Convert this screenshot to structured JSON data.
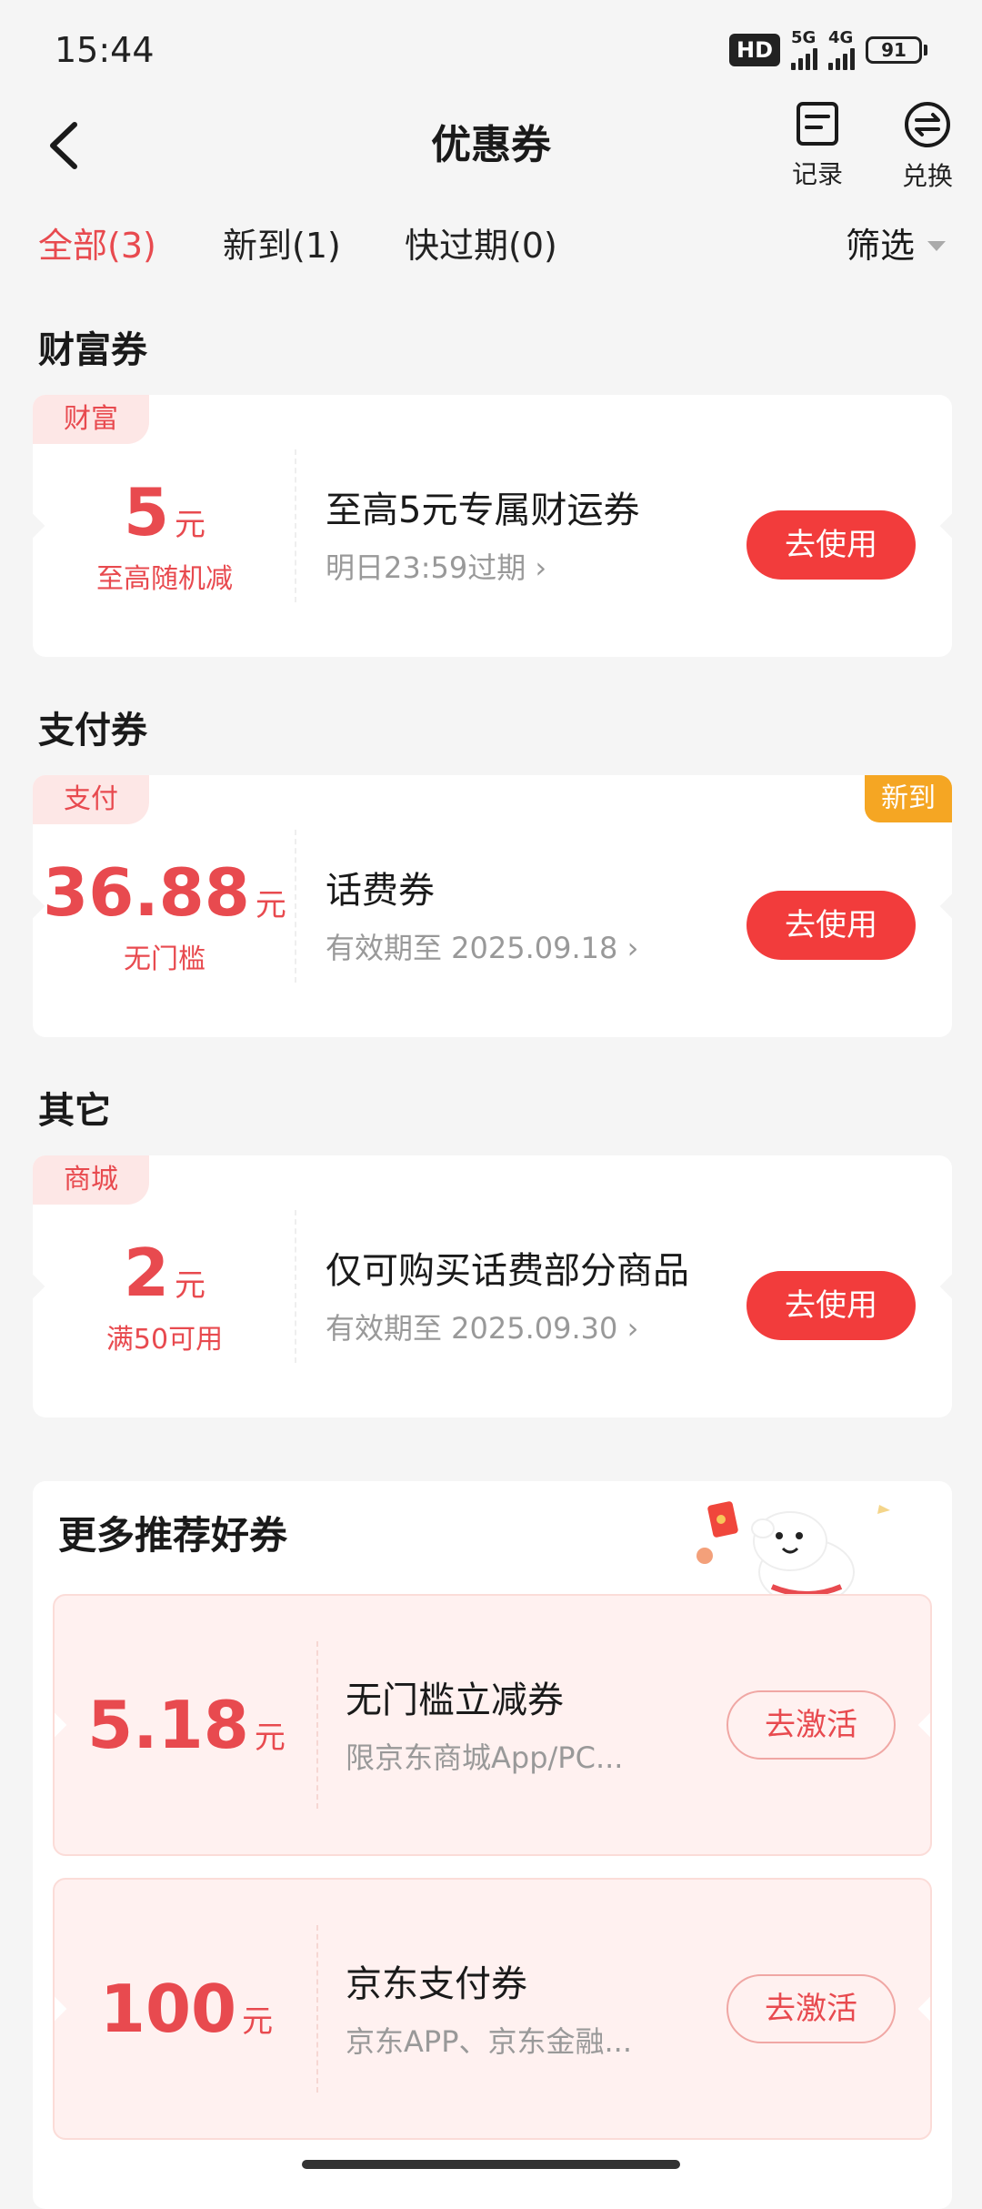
{
  "status_bar": {
    "time": "15:44",
    "hd": "HD",
    "net1": "5G",
    "net2": "4G",
    "battery": "91"
  },
  "nav": {
    "title": "优惠券",
    "record_label": "记录",
    "exchange_label": "兑换"
  },
  "tabs": [
    {
      "label": "全部(3)",
      "active": true
    },
    {
      "label": "新到(1)",
      "active": false
    },
    {
      "label": "快过期(0)",
      "active": false
    }
  ],
  "filter": {
    "label": "筛选"
  },
  "sections": [
    {
      "title": "财富券",
      "coupon": {
        "tag": "财富",
        "amount": "5",
        "unit": "元",
        "condition": "至高随机减",
        "title": "至高5元专属财运券",
        "subtitle": "明日23:59过期 ›",
        "button": "去使用"
      }
    },
    {
      "title": "支付券",
      "coupon": {
        "tag": "支付",
        "new_badge": "新到",
        "amount": "36.88",
        "unit": "元",
        "condition": "无门槛",
        "title": "话费券",
        "subtitle": "有效期至 2025.09.18 ›",
        "button": "去使用"
      }
    },
    {
      "title": "其它",
      "coupon": {
        "tag": "商城",
        "amount": "2",
        "unit": "元",
        "condition": "满50可用",
        "title": "仅可购买话费部分商品",
        "subtitle": "有效期至 2025.09.30 ›",
        "button": "去使用"
      }
    }
  ],
  "recommend": {
    "title": "更多推荐好券",
    "items": [
      {
        "amount": "5.18",
        "unit": "元",
        "title": "无门槛立减券",
        "subtitle": "限京东商城App/PC...",
        "button": "去激活"
      },
      {
        "amount": "100",
        "unit": "元",
        "title": "京东支付券",
        "subtitle": "京东APP、京东金融...",
        "button": "去激活"
      }
    ]
  },
  "colors": {
    "accent": "#e84a4f",
    "button": "#f23c3c",
    "new_badge": "#f5a623",
    "background": "#f5f5f5"
  }
}
